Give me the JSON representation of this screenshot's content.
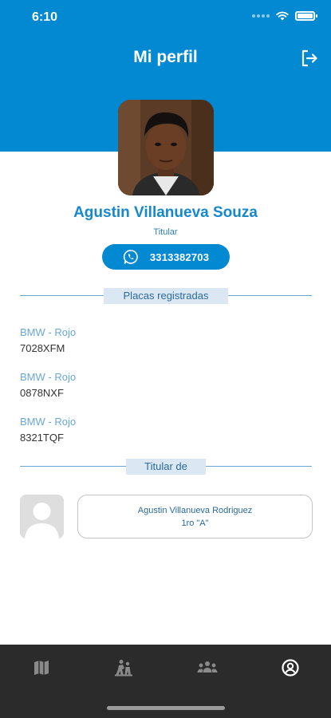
{
  "status_bar": {
    "time": "6:10"
  },
  "header": {
    "title": "Mi perfil",
    "logout_icon": "logout-icon"
  },
  "profile": {
    "name": "Agustin Villanueva Souza",
    "role": "Titular",
    "phone": "3313382703",
    "phone_icon": "whatsapp-icon"
  },
  "plates_section": {
    "label": "Placas registradas",
    "plates": [
      {
        "model": "BMW - Rojo",
        "number": "7028XFM"
      },
      {
        "model": "BMW - Rojo",
        "number": "0878NXF"
      },
      {
        "model": "BMW - Rojo",
        "number": "8321TQF"
      }
    ]
  },
  "holder_section": {
    "label": "Titular de",
    "holders": [
      {
        "name": "Agustin Villanueva Rodriguez",
        "unit": "1ro \"A\""
      }
    ]
  },
  "bottom_nav": {
    "items": [
      {
        "icon": "map-icon",
        "active": false
      },
      {
        "icon": "visitors-icon",
        "active": false
      },
      {
        "icon": "community-icon",
        "active": false
      },
      {
        "icon": "profile-icon",
        "active": true
      }
    ]
  },
  "colors": {
    "header": "#0289d1",
    "accent": "#1688cc",
    "divider": "#6aa6d6",
    "nav_background": "#2b2b2b"
  }
}
